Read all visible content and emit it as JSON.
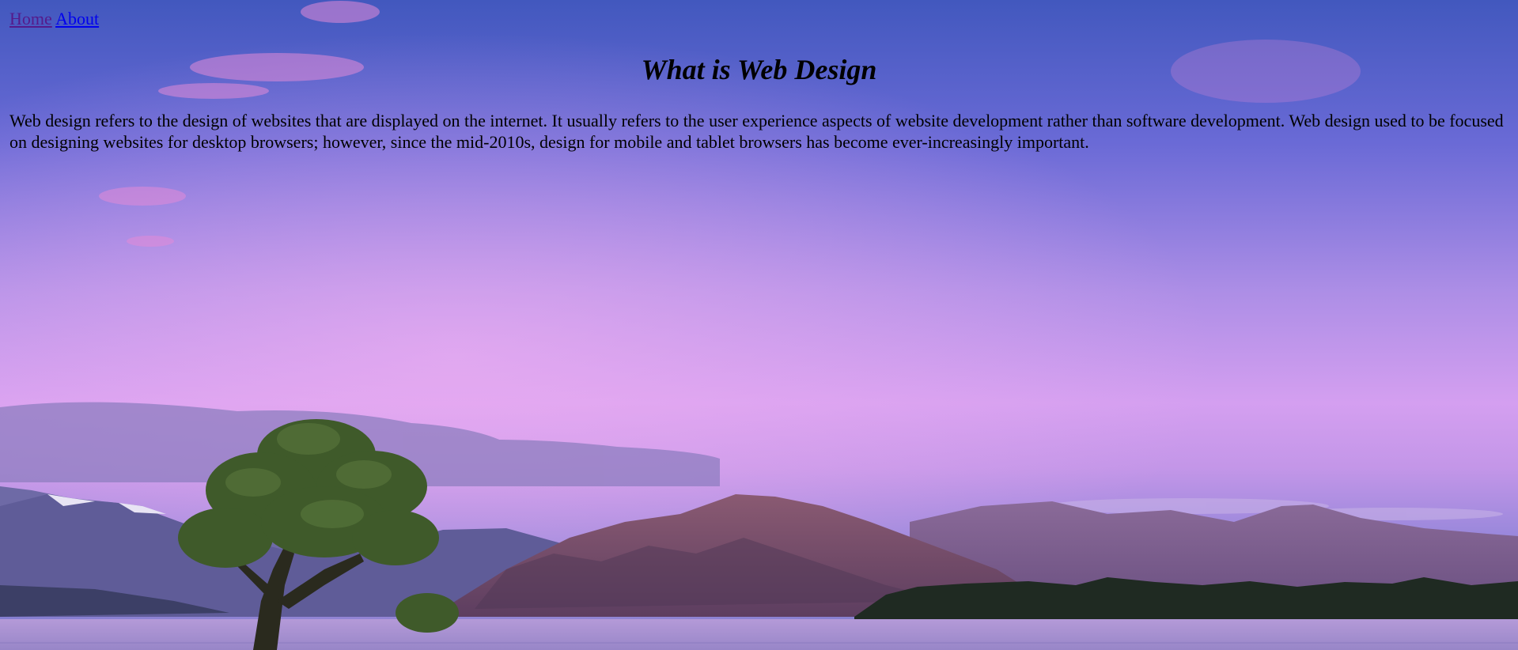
{
  "nav": {
    "links": [
      {
        "label": "Home",
        "visited": true
      },
      {
        "label": "About",
        "visited": false
      }
    ]
  },
  "main": {
    "title": "What is Web Design",
    "paragraph": "Web design refers to the design of websites that are displayed on the internet. It usually refers to the user experience aspects of website development rather than software development. Web design used to be focused on designing websites for desktop browsers; however, since the mid-2010s, design for mobile and tablet browsers has become ever-increasingly important."
  },
  "background": {
    "description_colors": {
      "sky_top": "#4a5fc4",
      "sky_mid": "#a88ae0",
      "sky_glow": "#e4a6ee",
      "mountains": "#6a4a78",
      "lake": "#a78fcf"
    }
  }
}
